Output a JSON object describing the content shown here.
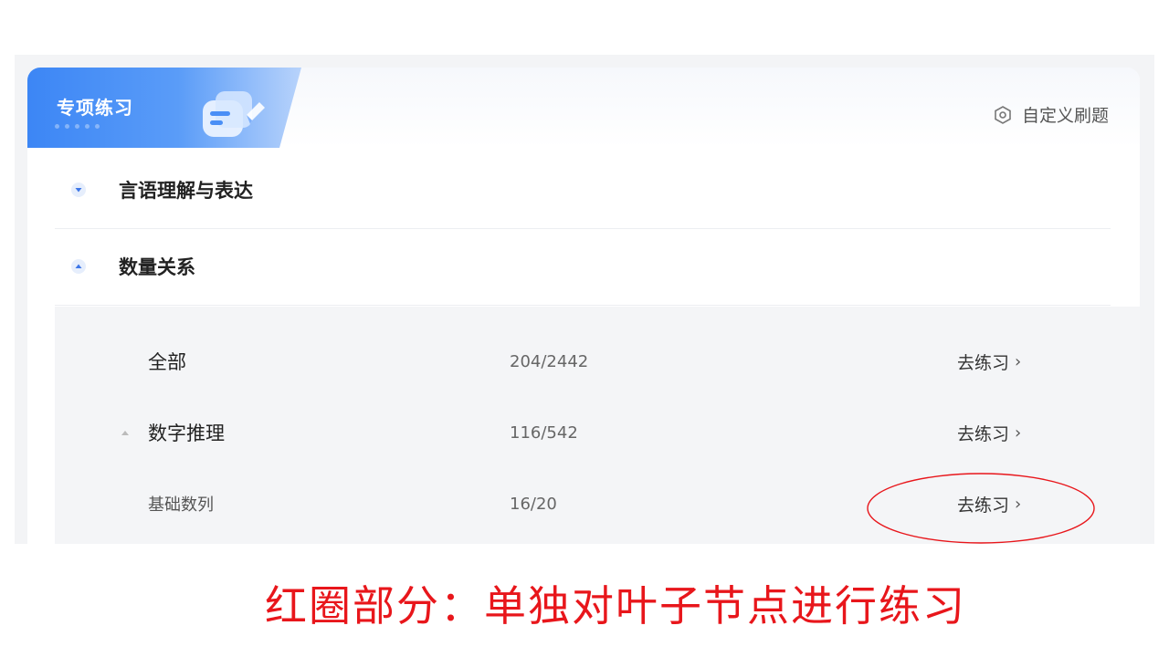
{
  "panel": {
    "title": "专项练习",
    "custom_button": {
      "label": "自定义刷题",
      "icon": "hexagon-settings-icon"
    }
  },
  "categories": [
    {
      "label": "言语理解与表达",
      "expanded": false,
      "icon": "triangle-down-icon"
    },
    {
      "label": "数量关系",
      "expanded": true,
      "icon": "triangle-up-icon"
    }
  ],
  "subitems": [
    {
      "name": "全部",
      "count": "204/2442",
      "action": "去练习",
      "chevron": "›"
    },
    {
      "name": "数字推理",
      "count": "116/542",
      "action": "去练习",
      "chevron": "›",
      "expanded": true
    },
    {
      "name": "基础数列",
      "count": "16/20",
      "action": "去练习",
      "chevron": "›",
      "leaf": true
    }
  ],
  "annotation": {
    "text": "红圈部分：单独对叶子节点进行练习",
    "color": "#e8161b"
  },
  "colors": {
    "accent": "#3c86f5",
    "annotation_red": "#e8161b"
  }
}
